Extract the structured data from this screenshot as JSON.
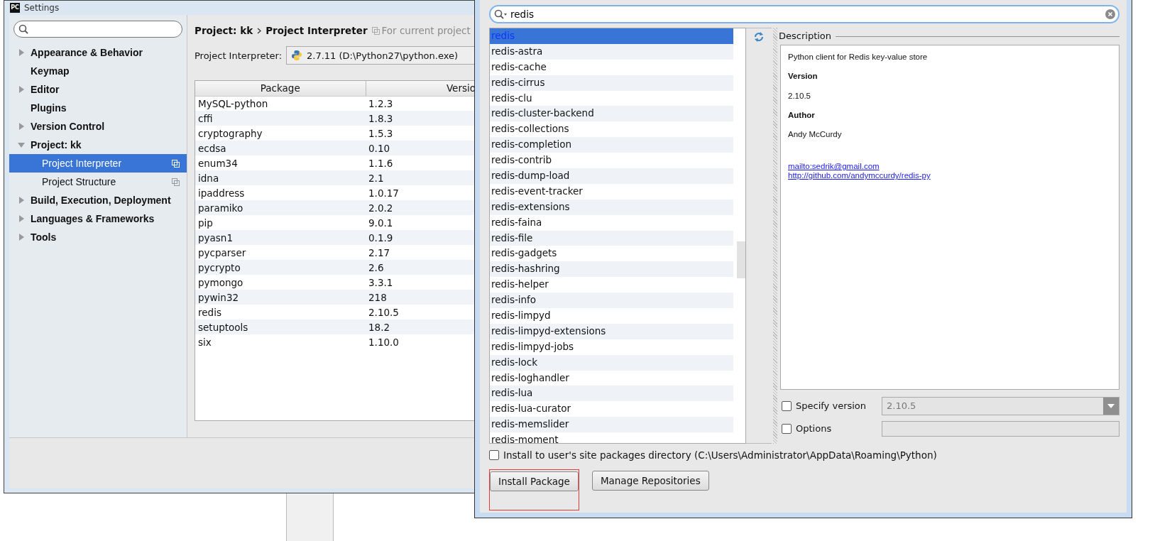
{
  "settings": {
    "app_icon_text": "PC",
    "title": "Settings",
    "tree": [
      {
        "label": "Appearance & Behavior",
        "kind": "group",
        "expanded": false,
        "selected": false
      },
      {
        "label": "Keymap",
        "kind": "leaf",
        "selected": false
      },
      {
        "label": "Editor",
        "kind": "group",
        "expanded": false,
        "selected": false
      },
      {
        "label": "Plugins",
        "kind": "leaf",
        "selected": false
      },
      {
        "label": "Version Control",
        "kind": "group",
        "expanded": false,
        "selected": false
      },
      {
        "label": "Project: kk",
        "kind": "group",
        "expanded": true,
        "selected": false,
        "children": [
          {
            "label": "Project Interpreter",
            "kind": "page",
            "selected": true
          },
          {
            "label": "Project Structure",
            "kind": "page",
            "selected": false
          }
        ]
      },
      {
        "label": "Build, Execution, Deployment",
        "kind": "group",
        "expanded": false,
        "selected": false
      },
      {
        "label": "Languages & Frameworks",
        "kind": "group",
        "expanded": false,
        "selected": false
      },
      {
        "label": "Tools",
        "kind": "group",
        "expanded": false,
        "selected": false
      }
    ],
    "breadcrumb": [
      "Project: kk",
      "Project Interpreter"
    ],
    "scope_note": "For current project",
    "interpreter_label": "Project Interpreter:",
    "interpreter_value": "2.7.11 (D:\\Python27\\python.exe)",
    "table": {
      "columns": [
        "Package",
        "Versio"
      ],
      "rows": [
        [
          "MySQL-python",
          "1.2.3"
        ],
        [
          "cffi",
          "1.8.3"
        ],
        [
          "cryptography",
          "1.5.3"
        ],
        [
          "ecdsa",
          "0.10"
        ],
        [
          "enum34",
          "1.1.6"
        ],
        [
          "idna",
          "2.1"
        ],
        [
          "ipaddress",
          "1.0.17"
        ],
        [
          "paramiko",
          "2.0.2"
        ],
        [
          "pip",
          "9.0.1"
        ],
        [
          "pyasn1",
          "0.1.9"
        ],
        [
          "pycparser",
          "2.17"
        ],
        [
          "pycrypto",
          "2.6"
        ],
        [
          "pymongo",
          "3.3.1"
        ],
        [
          "pywin32",
          "218"
        ],
        [
          "redis",
          "2.10.5"
        ],
        [
          "setuptools",
          "18.2"
        ],
        [
          "six",
          "1.10.0"
        ]
      ]
    }
  },
  "available_packages": {
    "search": {
      "value": "redis"
    },
    "packages": [
      {
        "name": "redis",
        "selected": true
      },
      {
        "name": "redis-astra",
        "selected": false
      },
      {
        "name": "redis-cache",
        "selected": false
      },
      {
        "name": "redis-cirrus",
        "selected": false
      },
      {
        "name": "redis-clu",
        "selected": false
      },
      {
        "name": "redis-cluster-backend",
        "selected": false
      },
      {
        "name": "redis-collections",
        "selected": false
      },
      {
        "name": "redis-completion",
        "selected": false
      },
      {
        "name": "redis-contrib",
        "selected": false
      },
      {
        "name": "redis-dump-load",
        "selected": false
      },
      {
        "name": "redis-event-tracker",
        "selected": false
      },
      {
        "name": "redis-extensions",
        "selected": false
      },
      {
        "name": "redis-faina",
        "selected": false
      },
      {
        "name": "redis-file",
        "selected": false
      },
      {
        "name": "redis-gadgets",
        "selected": false
      },
      {
        "name": "redis-hashring",
        "selected": false
      },
      {
        "name": "redis-helper",
        "selected": false
      },
      {
        "name": "redis-info",
        "selected": false
      },
      {
        "name": "redis-limpyd",
        "selected": false
      },
      {
        "name": "redis-limpyd-extensions",
        "selected": false
      },
      {
        "name": "redis-limpyd-jobs",
        "selected": false
      },
      {
        "name": "redis-lock",
        "selected": false
      },
      {
        "name": "redis-loghandler",
        "selected": false
      },
      {
        "name": "redis-lua",
        "selected": false
      },
      {
        "name": "redis-lua-curator",
        "selected": false
      },
      {
        "name": "redis-memslider",
        "selected": false
      },
      {
        "name": "redis-moment",
        "selected": false
      }
    ],
    "description": {
      "heading": "Description",
      "summary": "Python client for Redis key-value store",
      "version_label": "Version",
      "version": "2.10.5",
      "author_label": "Author",
      "author": "Andy McCurdy",
      "links": [
        "mailto:sedrik@gmail.com",
        "http://github.com/andymccurdy/redis-py"
      ]
    },
    "specify_version": {
      "label": "Specify version",
      "checked": false,
      "value": "2.10.5"
    },
    "options": {
      "label": "Options",
      "checked": false
    },
    "install_to_user": {
      "label": "Install to user's site packages directory (C:\\Users\\Administrator\\AppData\\Roaming\\Python)",
      "checked": false
    },
    "buttons": [
      {
        "label": "Install Package",
        "highlighted": true
      },
      {
        "label": "Manage Repositories",
        "highlighted": false
      }
    ]
  }
}
